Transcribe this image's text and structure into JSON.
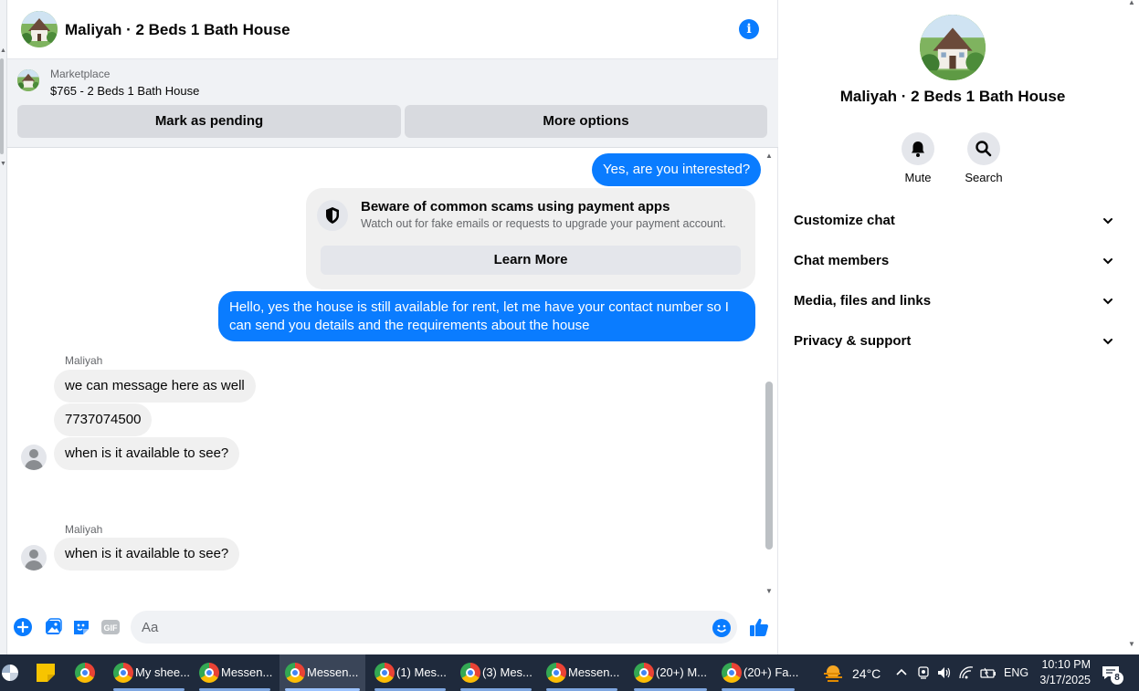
{
  "chat": {
    "title": "Maliyah · 2 Beds 1 Bath House",
    "marketplace_label": "Marketplace",
    "listing": "$765 - 2 Beds 1 Bath House",
    "mark_pending": "Mark as pending",
    "more_options": "More options"
  },
  "messages": {
    "out_1": "Yes, are you interested?",
    "scam_title": "Beware of common scams using payment apps",
    "scam_sub": "Watch out for fake emails or requests to upgrade your payment account.",
    "learn_more": "Learn More",
    "out_2": "Hello, yes the house is still available for rent, let me have your contact number so I can send you details and the requirements about the house",
    "sender_1": "Maliyah",
    "in_1": "we can message here as well",
    "in_2": "7737074500",
    "in_3": "when is it available to see?",
    "sender_2": "Maliyah",
    "in_4": "when is it available to see?"
  },
  "composer": {
    "placeholder": "Aa",
    "gif_label": "GIF"
  },
  "side": {
    "title": "Maliyah · 2 Beds 1 Bath House",
    "mute": "Mute",
    "search": "Search",
    "items": [
      "Customize chat",
      "Chat members",
      "Media, files and links",
      "Privacy & support"
    ]
  },
  "taskbar": {
    "apps": [
      "My shee...",
      "Messen...",
      "Messen...",
      "(1) Mes...",
      "(3) Mes...",
      "Messen...",
      "(20+) M...",
      "(20+) Fa..."
    ],
    "temperature": "24°C",
    "lang": "ENG",
    "time": "10:10 PM",
    "date": "3/17/2025",
    "notifications": "8"
  },
  "colors": {
    "accent": "#0a7cff",
    "incoming_bubble": "#f0f0f0",
    "taskbar": "#1f2a3c"
  },
  "icons": [
    "info-icon",
    "shield-icon",
    "plus-icon",
    "photo-icon",
    "sticker-icon",
    "gif-icon",
    "emoji-icon",
    "like-icon",
    "bell-icon",
    "search-icon",
    "chevron-down-icon"
  ]
}
